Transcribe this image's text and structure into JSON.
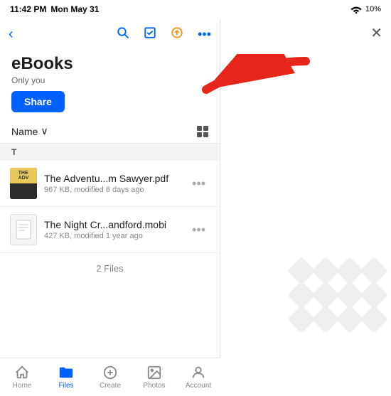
{
  "statusBar": {
    "time": "11:42 PM",
    "day": "Mon May 31",
    "battery": "10%"
  },
  "nav": {
    "backLabel": "‹",
    "searchLabel": "🔍",
    "checkLabel": "☑",
    "uploadLabel": "⬆",
    "moreLabel": "•••",
    "closeLabel": "✕"
  },
  "folder": {
    "title": "eBooks",
    "subtitle": "Only you",
    "shareLabel": "Share"
  },
  "sortBar": {
    "sortLabel": "Name",
    "sortIcon": "∨"
  },
  "sectionHeaders": [
    "T"
  ],
  "files": [
    {
      "name": "The Adventu...m Sawyer.pdf",
      "meta": "967 KB, modified 6 days ago",
      "type": "pdf"
    },
    {
      "name": "The Night Cr...andford.mobi",
      "meta": "427 KB, modified 1 year ago",
      "type": "mobi"
    }
  ],
  "fileCount": "2 Files",
  "tabs": [
    {
      "label": "Home",
      "icon": "⌂",
      "active": false
    },
    {
      "label": "Files",
      "icon": "📁",
      "active": true
    },
    {
      "label": "Create",
      "icon": "⊕",
      "active": false
    },
    {
      "label": "Photos",
      "icon": "⛰",
      "active": false
    },
    {
      "label": "Account",
      "icon": "⚇",
      "active": false
    }
  ]
}
